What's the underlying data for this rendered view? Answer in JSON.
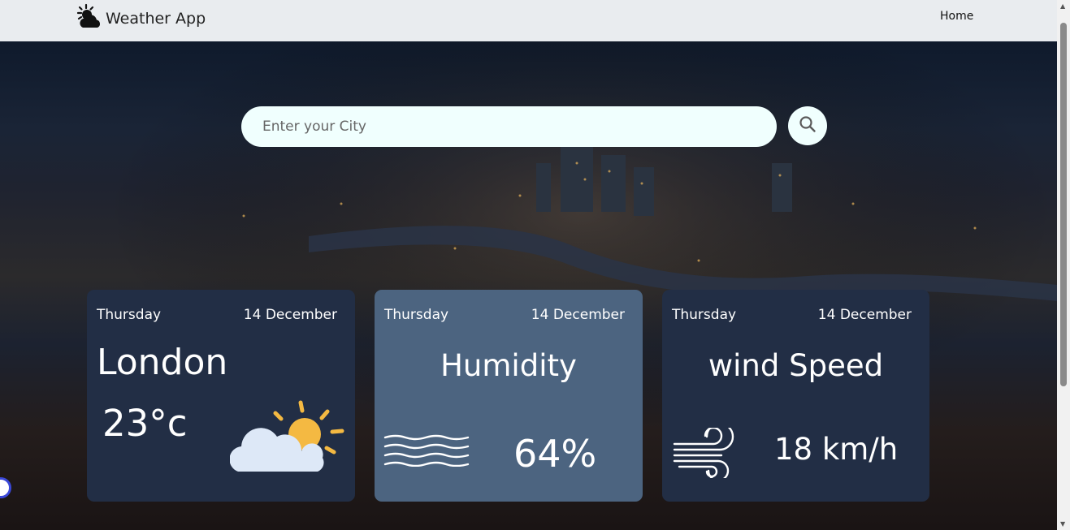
{
  "navbar": {
    "brand_icon": "cloud-sun-icon",
    "brand_name": "Weather App",
    "links": [
      {
        "label": "Home"
      }
    ]
  },
  "search": {
    "placeholder": "Enter your City",
    "value": "",
    "button_icon": "search-icon"
  },
  "cards": [
    {
      "day": "Thursday",
      "date": "14 December",
      "city": "London",
      "temperature": "23°c",
      "icon": "partly-sunny-icon"
    },
    {
      "day": "Thursday",
      "date": "14 December",
      "title": "Humidity",
      "value": "64%",
      "icon": "waves-icon"
    },
    {
      "day": "Thursday",
      "date": "14 December",
      "title": "wind Speed",
      "value": "18 km/h",
      "icon": "wind-icon"
    }
  ],
  "colors": {
    "navbar_bg": "#e9ecef",
    "card_dark": "#222e45",
    "card_mid": "#4c6480",
    "search_bg": "#f0fffe"
  }
}
